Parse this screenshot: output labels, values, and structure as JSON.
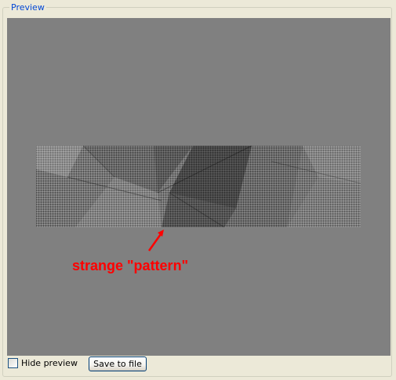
{
  "groupbox": {
    "legend": "Preview"
  },
  "annotation": {
    "text": "strange \"pattern\"",
    "color": "#ff0000"
  },
  "controls": {
    "hide_preview_label": "Hide preview",
    "hide_preview_checked": false,
    "save_button_label": "Save to file"
  },
  "colors": {
    "preview_background": "#808080",
    "legend_text": "#0046d5",
    "window_background": "#ece9d8"
  }
}
